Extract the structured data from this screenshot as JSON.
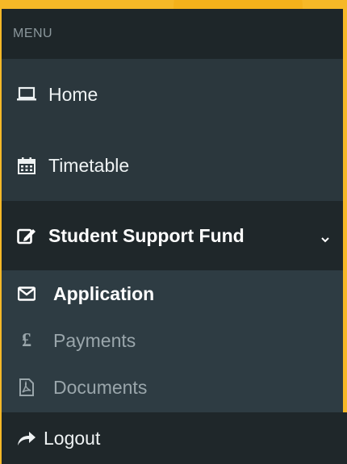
{
  "sidebar": {
    "header": "MENU",
    "items": [
      {
        "label": "Home",
        "icon": "laptop-icon"
      },
      {
        "label": "Timetable",
        "icon": "calendar-icon"
      },
      {
        "label": "Student Support Fund",
        "icon": "edit-icon"
      }
    ],
    "submenu": [
      {
        "label": "Application",
        "icon": "envelope-icon"
      },
      {
        "label": "Payments",
        "icon": "pound-icon",
        "symbol": "£"
      },
      {
        "label": "Documents",
        "icon": "pdf-file-icon"
      }
    ],
    "logout": {
      "label": "Logout",
      "icon": "share-arrow-icon"
    }
  },
  "colors": {
    "background_accent": "#f6b827",
    "sidebar": "#2b373d",
    "active_item": "#1f272a"
  }
}
